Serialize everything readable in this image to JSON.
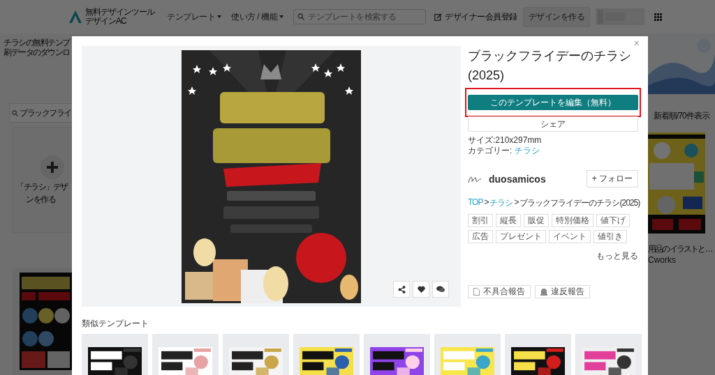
{
  "header": {
    "logo_lines": [
      "無料デザインツール",
      "デザインAC"
    ],
    "nav": [
      {
        "label": "テンプレート"
      },
      {
        "label": "使い方 / 機能"
      }
    ],
    "search": {
      "placeholder": "テンプレートを検索する"
    },
    "register_link": "デザイナー会員登録",
    "create_button": "デザインを作る"
  },
  "background": {
    "intro_lines": [
      "チラシの無料テンプ",
      "刷データのダウンロ"
    ],
    "search_value": "ブラックフライ",
    "create_card_lines": [
      "「チラシ」デザ",
      "ンを作る"
    ],
    "sort": "新着順/70件表示",
    "side_item": {
      "title": "用品のイラストと…",
      "author": "Cworks"
    }
  },
  "modal": {
    "close": "×",
    "title": "ブラックフライデーのチラシ(2025)",
    "edit_button": {
      "label": "このテンプレートを編集（無料）",
      "highlighted": true
    },
    "share_button": "シェア",
    "size": "サイズ:210x297mm",
    "category_label": "カテゴリー:",
    "category": "チラシ",
    "author": "duosamicos",
    "follow_button": "+ フォロー",
    "breadcrumb": [
      {
        "label": "TOP",
        "kind": "link",
        "separator": ">"
      },
      {
        "label": "チラシ",
        "kind": "link",
        "separator": ">"
      },
      {
        "label": "ブラックフライデーのチラシ(2025)",
        "kind": "current"
      }
    ],
    "tags": [
      "割引",
      "縦長",
      "販促",
      "特別価格",
      "値下げ",
      "広告",
      "プレゼント",
      "イベント",
      "値引き"
    ],
    "more_link": "もっと見る",
    "reports": [
      {
        "label": "不具合報告",
        "kind": "bug"
      },
      {
        "label": "違反報告",
        "kind": "violation"
      }
    ],
    "similar": {
      "heading": "類似テンプレート"
    }
  }
}
